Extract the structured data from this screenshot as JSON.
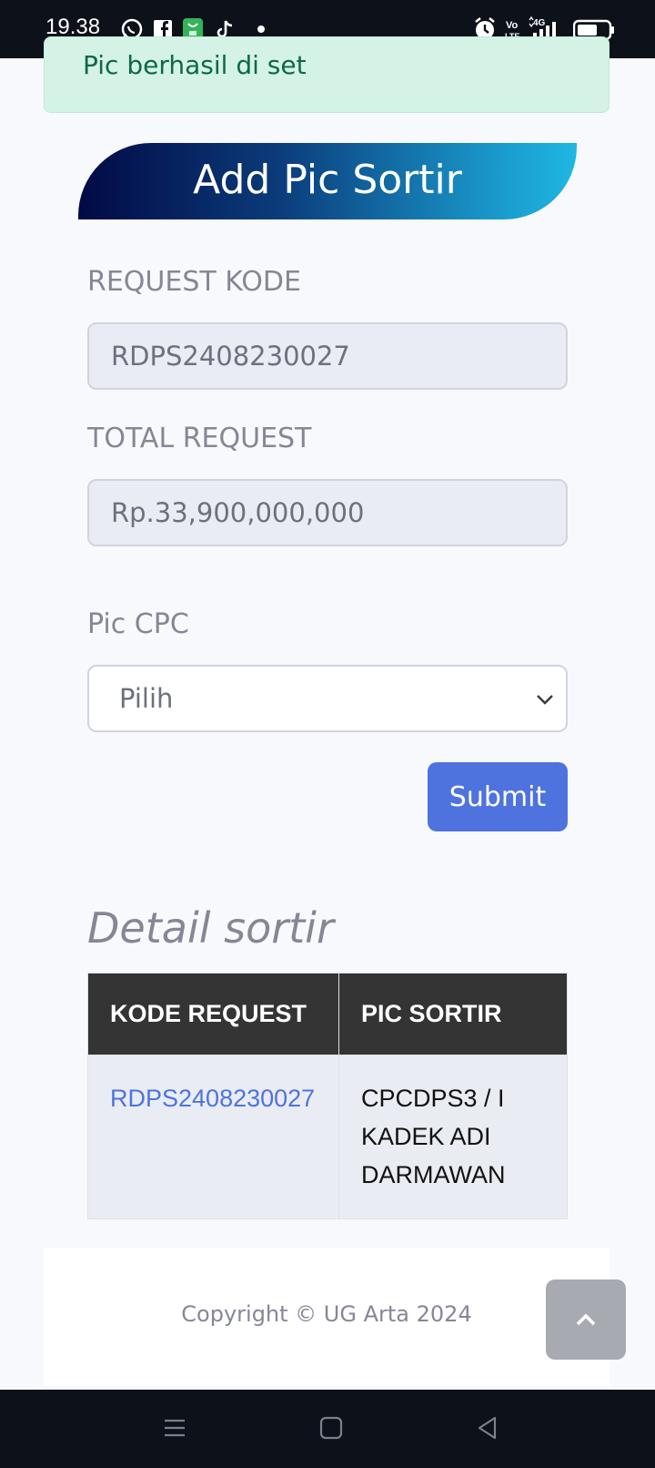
{
  "status_bar": {
    "time": "19.38",
    "icons": [
      "whatsapp-icon",
      "facebook-icon",
      "shop-app-icon",
      "tiktok-icon",
      "dot-icon",
      "alarm-icon",
      "volte-icon",
      "signal-4g-icon",
      "battery-icon"
    ]
  },
  "alert": {
    "message": "Pic berhasil di set"
  },
  "header": {
    "title": "Add Pic Sortir"
  },
  "form": {
    "request_kode": {
      "label": "REQUEST KODE",
      "value": "RDPS2408230027"
    },
    "total_request": {
      "label": "TOTAL REQUEST",
      "value": "Rp.33,900,000,000"
    },
    "pic_cpc": {
      "label": "Pic CPC",
      "selected": "Pilih"
    },
    "submit_label": "Submit"
  },
  "detail": {
    "title": "Detail sortir",
    "columns": [
      "KODE REQUEST",
      "PIC SORTIR"
    ],
    "rows": [
      {
        "kode": "RDPS2408230027",
        "pic": "CPCDPS3 / I KADEK ADI DARMAWAN"
      }
    ]
  },
  "footer": {
    "copyright": "Copyright © UG Arta 2024"
  },
  "colors": {
    "primary": "#4e73df",
    "alert_bg": "#d4f3e6",
    "alert_text": "#0f6847",
    "banner_start": "#020a45",
    "banner_end": "#1fb7e3",
    "table_header": "#343434"
  }
}
